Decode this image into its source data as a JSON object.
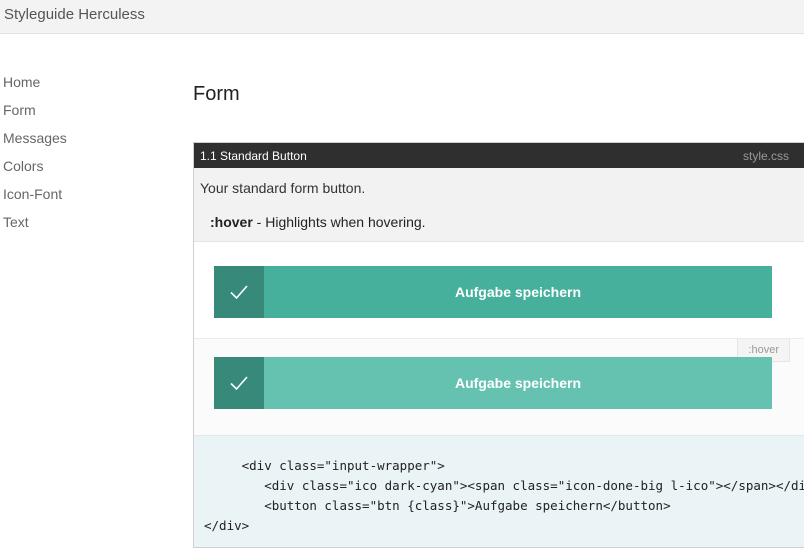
{
  "header": {
    "title": "Styleguide Herculess"
  },
  "sidebar": {
    "items": [
      {
        "label": "Home"
      },
      {
        "label": "Form"
      },
      {
        "label": "Messages"
      },
      {
        "label": "Colors"
      },
      {
        "label": "Icon-Font"
      },
      {
        "label": "Text"
      }
    ]
  },
  "main": {
    "title": "Form",
    "panel": {
      "title": "1.1 Standard Button",
      "file": "style.css",
      "description": "Your standard form button.",
      "modifier": {
        "name": ":hover",
        "text": " - Highlights when hovering."
      },
      "examples": [
        {
          "button_label": "Aufgabe speichern",
          "icon": "check-icon",
          "icon_bg": "#378a7a",
          "button_bg": "#47b09d"
        },
        {
          "tag": ":hover",
          "button_label": "Aufgabe speichern",
          "icon": "check-icon",
          "icon_bg": "#378a7a",
          "button_bg": "#65c2b1"
        }
      ],
      "code": "     <div class=\"input-wrapper\">\n        <div class=\"ico dark-cyan\"><span class=\"icon-done-big l-ico\"></span></div>\n        <button class=\"btn {class}\">Aufgabe speichern</button>\n</div>"
    }
  }
}
